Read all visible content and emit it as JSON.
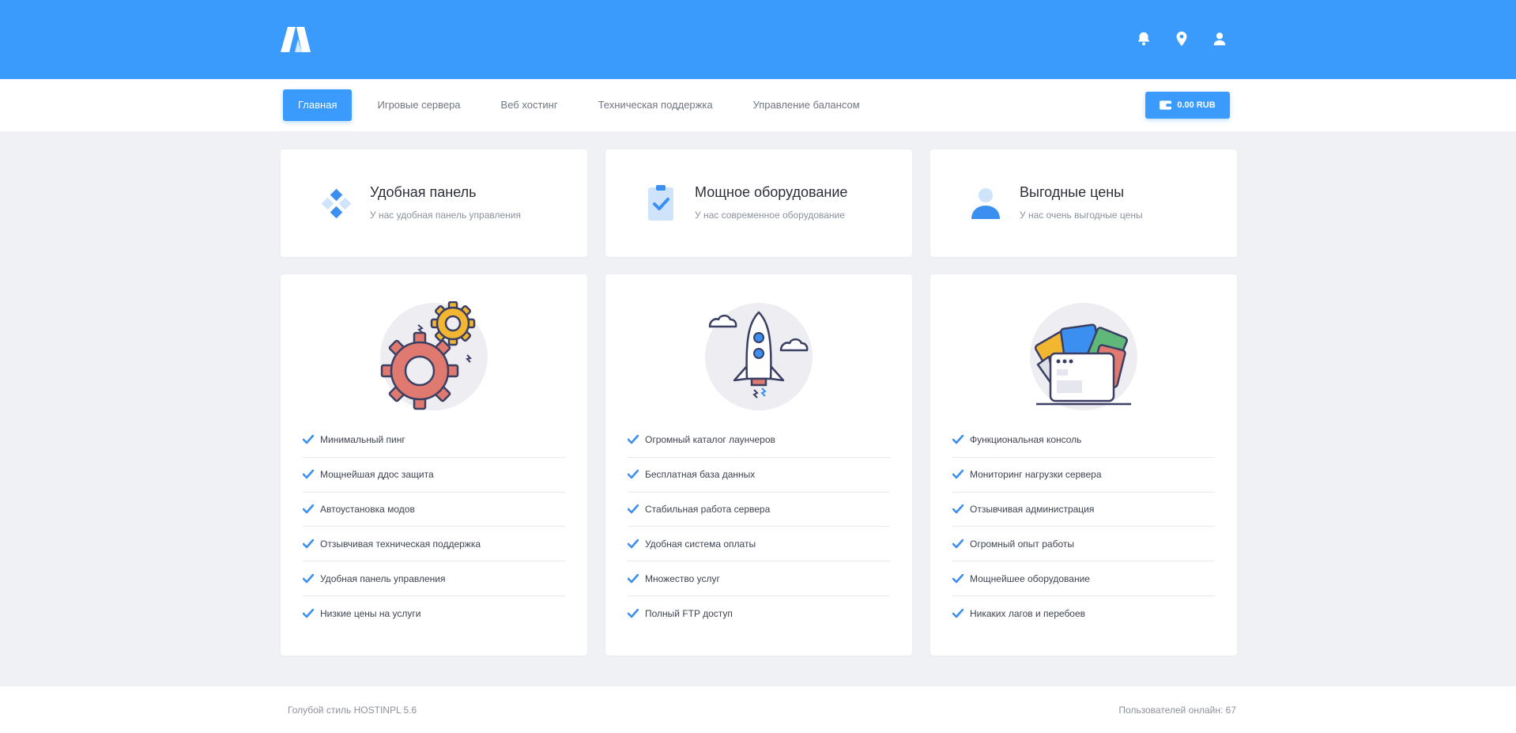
{
  "header": {
    "icons": [
      "bell-icon",
      "map-pin-icon",
      "user-icon"
    ],
    "brand_color": "#3a9bfc"
  },
  "nav": {
    "items": [
      {
        "label": "Главная",
        "active": true
      },
      {
        "label": "Игровые сервера",
        "active": false
      },
      {
        "label": "Веб хостинг",
        "active": false
      },
      {
        "label": "Техническая поддержка",
        "active": false
      },
      {
        "label": "Управление балансом",
        "active": false
      }
    ],
    "balance": "0.00 RUB"
  },
  "features": [
    {
      "title": "Удобная панель",
      "subtitle": "У нас удобная панель управления",
      "icon": "diamond-grid-icon"
    },
    {
      "title": "Мощное оборудование",
      "subtitle": "У нас современное оборудование",
      "icon": "clipboard-check-icon"
    },
    {
      "title": "Выгодные цены",
      "subtitle": "У нас очень выгодные цены",
      "icon": "user-icon"
    }
  ],
  "cards": [
    {
      "illustration": "gears-icon",
      "items": [
        "Минимальный пинг",
        "Мощнейшая ддос защита",
        "Автоустановка модов",
        "Отзывчивая техническая поддержка",
        "Удобная панель управления",
        "Низкие цены на услуги"
      ]
    },
    {
      "illustration": "rocket-icon",
      "items": [
        "Огромный каталог лаунчеров",
        "Бесплатная база данных",
        "Стабильная работа сервера",
        "Удобная система оплаты",
        "Множество услуг",
        "Полный FTP доступ"
      ]
    },
    {
      "illustration": "browser-windows-icon",
      "items": [
        "Функциональная консоль",
        "Мониторинг нагрузки сервера",
        "Отзывчивая администрация",
        "Огромный опыт работы",
        "Мощнейшее оборудование",
        "Никаких лагов и перебоев"
      ]
    }
  ],
  "footer": {
    "left": "Голубой стиль HOSTINPL 5.6",
    "right": "Пользователей онлайн: 67"
  }
}
